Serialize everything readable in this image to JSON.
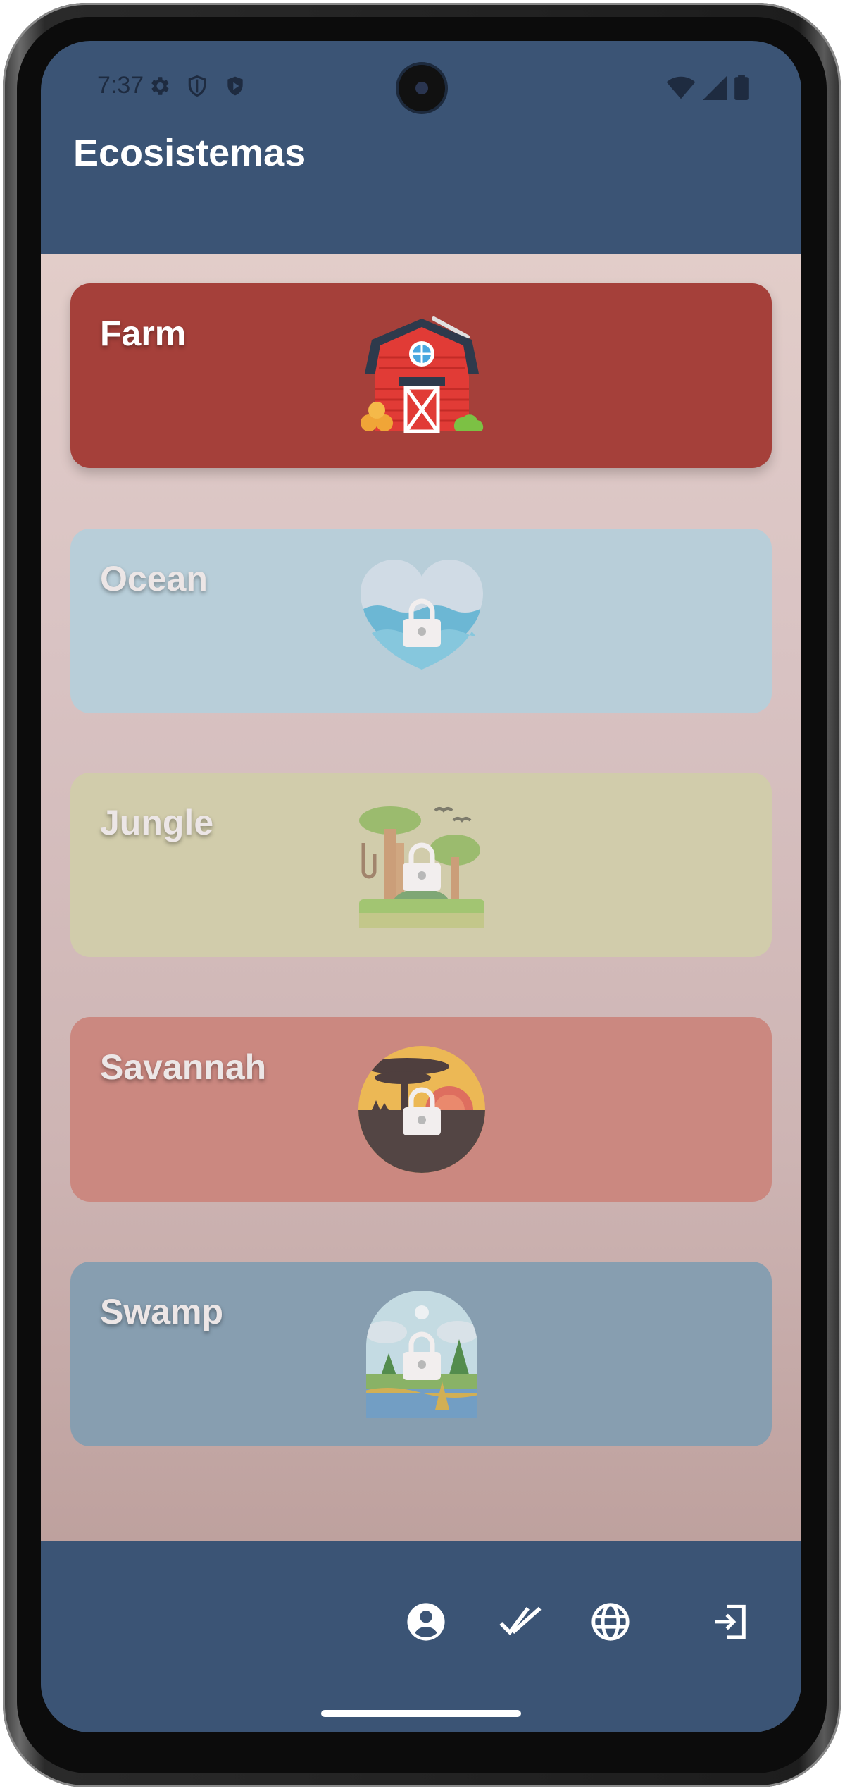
{
  "status_bar": {
    "time": "7:37",
    "left_icons": [
      "settings-icon",
      "shield-icon",
      "play-protect-icon"
    ],
    "right_icons": [
      "wifi-icon",
      "signal-icon",
      "battery-icon"
    ]
  },
  "app_bar": {
    "title": "Ecosistemas"
  },
  "ecosystems": [
    {
      "label": "Farm",
      "icon": "barn-icon",
      "locked": false,
      "color": "#a5403a"
    },
    {
      "label": "Ocean",
      "icon": "ocean-heart-icon",
      "locked": true,
      "color": "#b8ced9"
    },
    {
      "label": "Jungle",
      "icon": "jungle-icon",
      "locked": true,
      "color": "#d1ccab"
    },
    {
      "label": "Savannah",
      "icon": "savannah-icon",
      "locked": true,
      "color": "#cb8880"
    },
    {
      "label": "Swamp",
      "icon": "swamp-icon",
      "locked": true,
      "color": "#879eb0"
    }
  ],
  "bottom_nav": {
    "items": [
      "profile-icon",
      "check-icon",
      "globe-icon",
      "logout-icon"
    ]
  },
  "colors": {
    "app_bar": "#3b5475",
    "accent": "#ffffff"
  }
}
